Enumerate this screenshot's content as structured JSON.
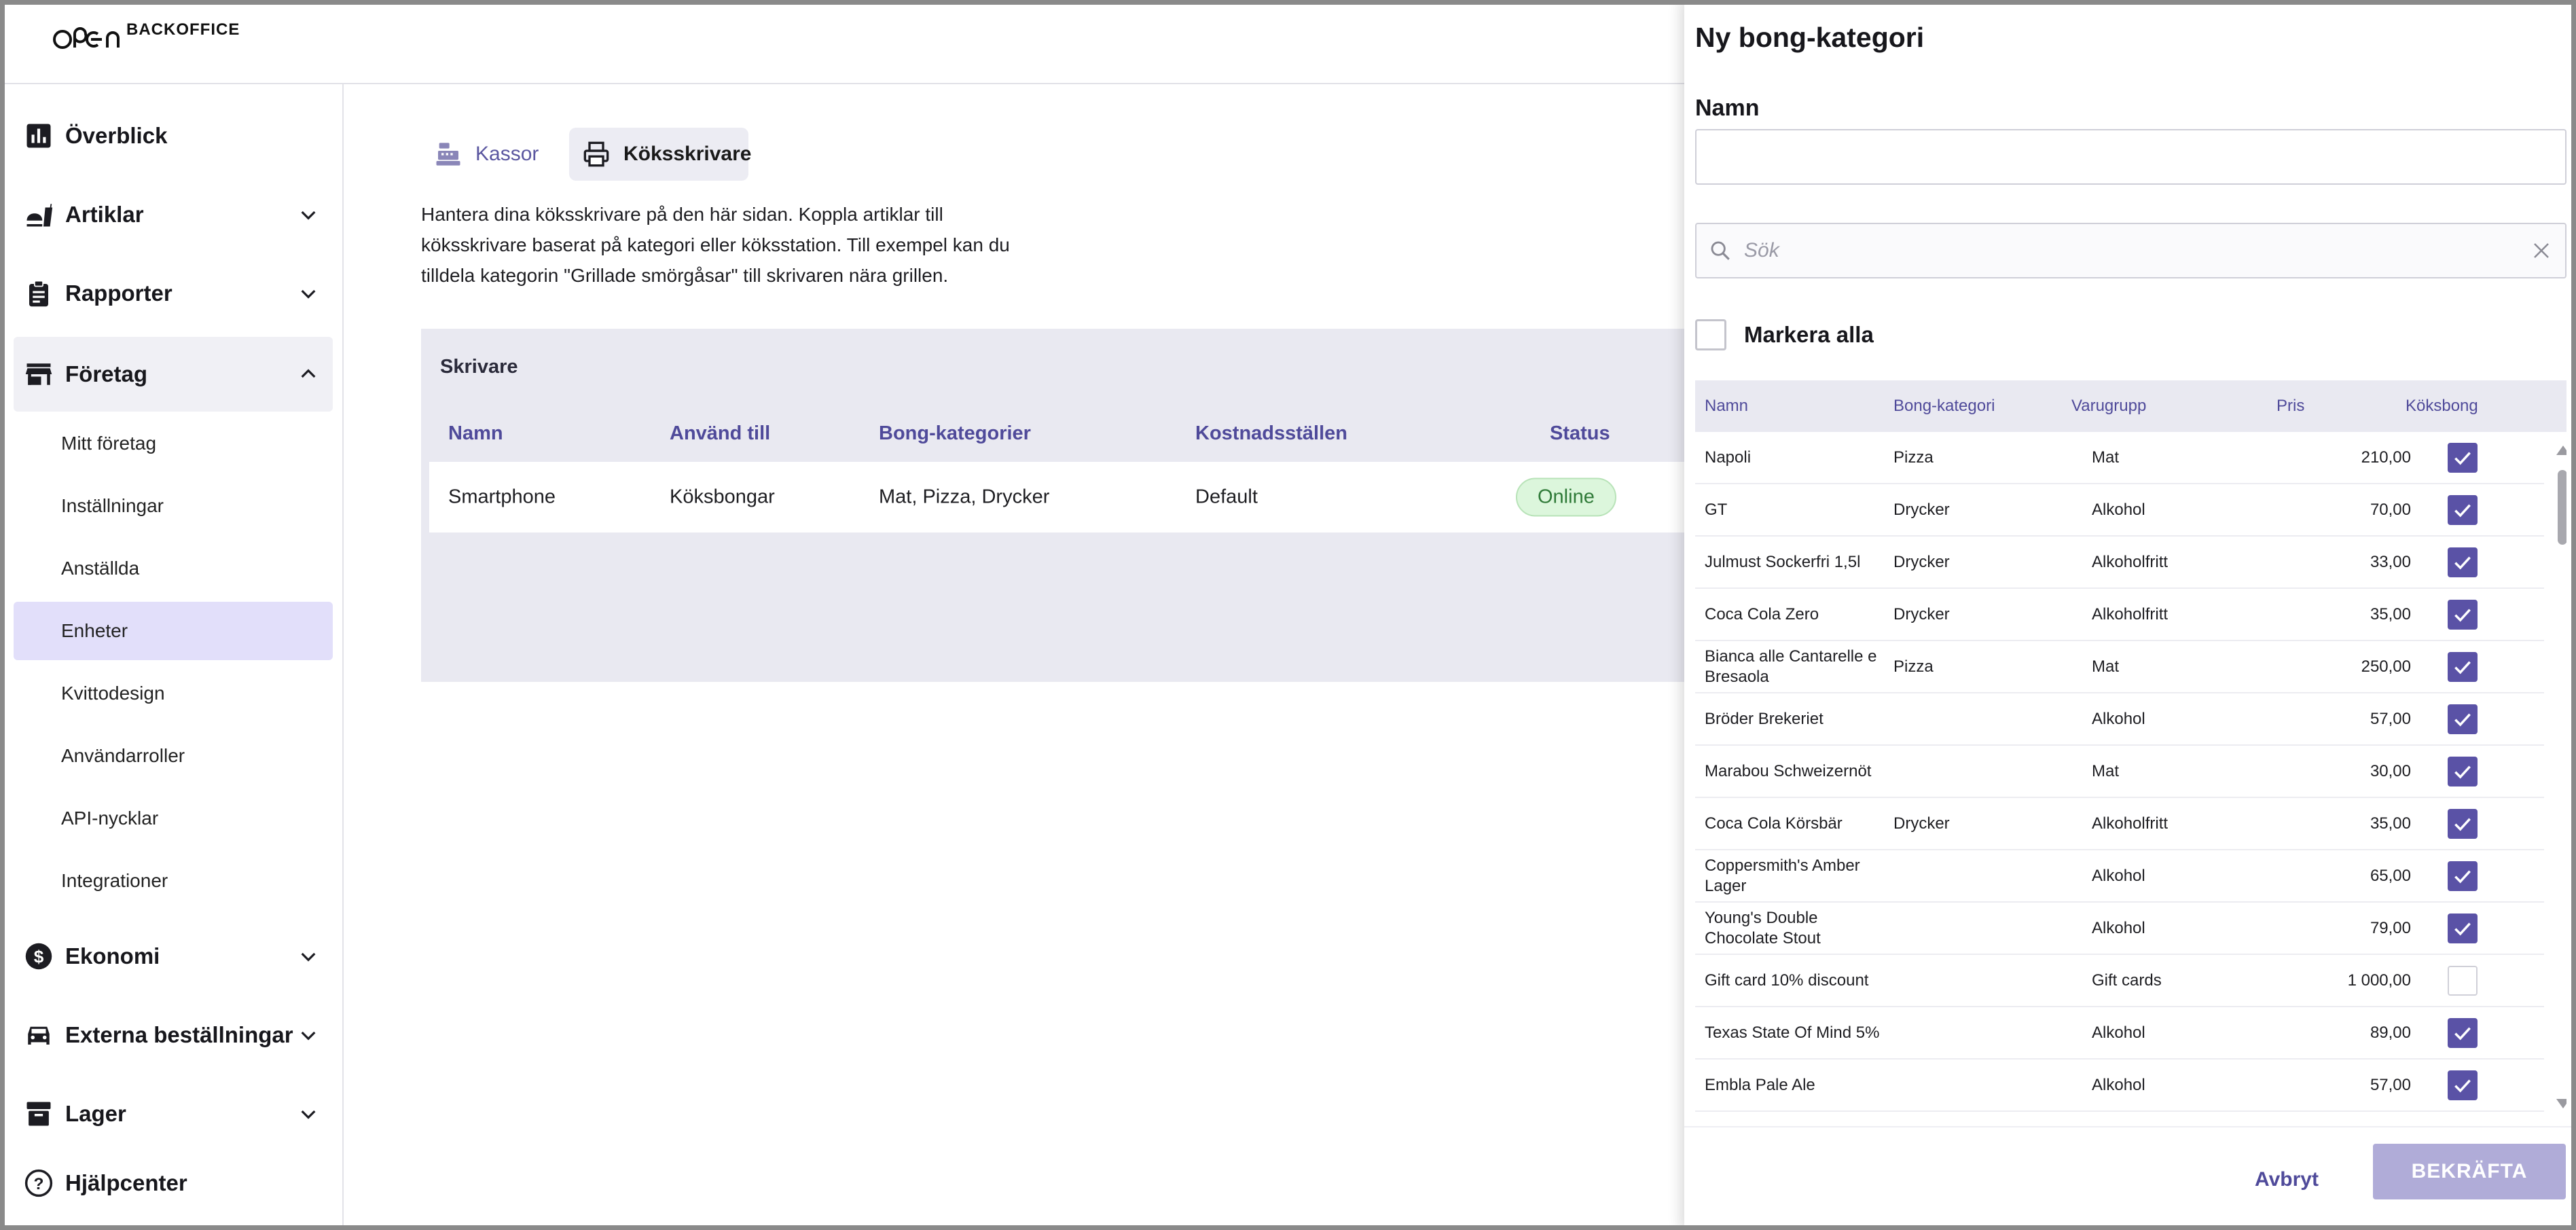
{
  "app": {
    "logo_text": "BACKOFFICE"
  },
  "sidebar": {
    "overview": "Överblick",
    "articles": "Artiklar",
    "reports": "Rapporter",
    "company": "Företag",
    "company_items": [
      "Mitt företag",
      "Inställningar",
      "Anställda",
      "Enheter",
      "Kvittodesign",
      "Användarroller",
      "API-nycklar",
      "Integrationer"
    ],
    "economy": "Ekonomi",
    "external_orders": "Externa beställningar",
    "stock": "Lager",
    "help": "Hjälpcenter"
  },
  "tabs": {
    "registers": "Kassor",
    "kitchen_printers": "Köksskrivare"
  },
  "description": "Hantera dina köksskrivare på den här sidan. Koppla artiklar till köksskrivare baserat på kategori eller köksstation. Till exempel kan du tilldela kategorin \"Grillade smörgåsar\" till skrivaren nära grillen.",
  "printers": {
    "title": "Skrivare",
    "columns": {
      "name": "Namn",
      "used_for": "Använd till",
      "categories": "Bong-kategorier",
      "cost_centers": "Kostnadsställen",
      "status": "Status"
    },
    "rows": [
      {
        "name": "Smartphone",
        "used_for": "Köksbongar",
        "categories": "Mat, Pizza, Drycker",
        "cost_centers": "Default",
        "status": "Online"
      }
    ]
  },
  "drawer": {
    "title": "Ny bong-kategori",
    "name_label": "Namn",
    "name_value": "",
    "search_placeholder": "Sök",
    "select_all": "Markera alla",
    "columns": {
      "name": "Namn",
      "category": "Bong-kategori",
      "group": "Varugrupp",
      "price": "Pris",
      "kitchen_ticket": "Köksbong"
    },
    "items": [
      {
        "name": "Napoli",
        "category": "Pizza",
        "group": "Mat",
        "price": "210,00",
        "checked": true
      },
      {
        "name": "GT",
        "category": "Drycker",
        "group": "Alkohol",
        "price": "70,00",
        "checked": true
      },
      {
        "name": "Julmust Sockerfri 1,5l",
        "category": "Drycker",
        "group": "Alkoholfritt",
        "price": "33,00",
        "checked": true
      },
      {
        "name": "Coca Cola Zero",
        "category": "Drycker",
        "group": "Alkoholfritt",
        "price": "35,00",
        "checked": true
      },
      {
        "name": "Bianca alle Cantarelle e Bresaola",
        "category": "Pizza",
        "group": "Mat",
        "price": "250,00",
        "checked": true
      },
      {
        "name": "Bröder Brekeriet",
        "category": "",
        "group": "Alkohol",
        "price": "57,00",
        "checked": true
      },
      {
        "name": "Marabou Schweizernöt",
        "category": "",
        "group": "Mat",
        "price": "30,00",
        "checked": true
      },
      {
        "name": "Coca Cola Körsbär",
        "category": "Drycker",
        "group": "Alkoholfritt",
        "price": "35,00",
        "checked": true
      },
      {
        "name": "Coppersmith's Amber Lager",
        "category": "",
        "group": "Alkohol",
        "price": "65,00",
        "checked": true
      },
      {
        "name": "Young's Double Chocolate Stout",
        "category": "",
        "group": "Alkohol",
        "price": "79,00",
        "checked": true
      },
      {
        "name": "Gift card 10% discount",
        "category": "",
        "group": "Gift cards",
        "price": "1 000,00",
        "checked": false
      },
      {
        "name": "Texas State Of Mind 5%",
        "category": "",
        "group": "Alkohol",
        "price": "89,00",
        "checked": true
      },
      {
        "name": "Embla Pale Ale",
        "category": "",
        "group": "Alkohol",
        "price": "57,00",
        "checked": true
      }
    ],
    "cancel": "Avbryt",
    "confirm": "BEKRÄFTA"
  },
  "colors": {
    "accent": "#5a52a6",
    "accent_text": "#4f4a9a",
    "active_nav_bg": "#e2dffa",
    "online_bg": "#dcf6dc",
    "online_text": "#2f7a38",
    "confirm_disabled": "#b0acd8"
  }
}
